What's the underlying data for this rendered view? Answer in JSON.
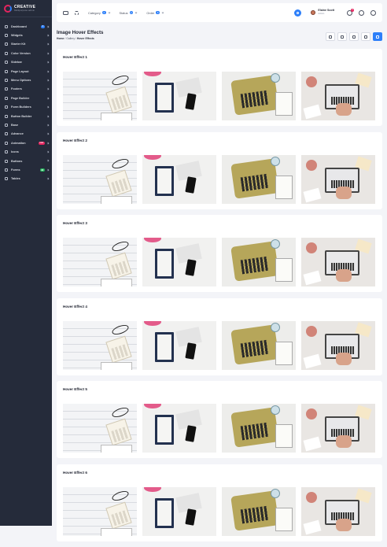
{
  "brand": {
    "name": "CREATIVE",
    "tagline": "Multipurpose admin"
  },
  "sidebar": {
    "items": [
      {
        "label": "Dashboard",
        "icon": "dashboard-icon",
        "badge": "4",
        "badge_color": "#2d7ff9"
      },
      {
        "label": "Widgets",
        "icon": "widgets-icon"
      },
      {
        "label": "Starter Kit",
        "icon": "starter-kit-icon"
      },
      {
        "label": "Color Version",
        "icon": "palette-icon"
      },
      {
        "label": "Sidebar",
        "icon": "sidebar-icon"
      },
      {
        "label": "Page Layout",
        "icon": "layout-icon"
      },
      {
        "label": "Menu Options",
        "icon": "menu-icon"
      },
      {
        "label": "Footers",
        "icon": "footer-icon"
      },
      {
        "label": "Page Builder",
        "icon": "builder-icon"
      },
      {
        "label": "Form Builders",
        "icon": "form-icon"
      },
      {
        "label": "Button Builder",
        "icon": "button-icon"
      },
      {
        "label": "Base",
        "icon": "base-icon"
      },
      {
        "label": "Advance",
        "icon": "advance-icon"
      },
      {
        "label": "Animation",
        "icon": "animation-icon",
        "badge": "Hot",
        "badge_color": "#e5245e"
      },
      {
        "label": "Icons",
        "icon": "icons-icon"
      },
      {
        "label": "Buttons",
        "icon": "buttons-icon"
      },
      {
        "label": "Forms",
        "icon": "forms-icon",
        "badge": "18",
        "badge_color": "#22b35a"
      },
      {
        "label": "Tables",
        "icon": "tables-icon"
      }
    ]
  },
  "topbar": {
    "filters": [
      {
        "label": "Category",
        "count": "4"
      },
      {
        "label": "Status",
        "count": "2"
      },
      {
        "label": "Order",
        "count": "6"
      }
    ],
    "user": {
      "name": "Elaine Scott",
      "role": "Admin"
    },
    "notification_count": "4"
  },
  "page": {
    "title": "Image Hover Effects",
    "breadcrumb": {
      "home": "Home",
      "sep": "/",
      "section": "Gallery",
      "current": "Hover Effects"
    }
  },
  "cards": [
    {
      "title": "Hover Effect 1"
    },
    {
      "title": "Hover Effect 2"
    },
    {
      "title": "Hover Effect 3"
    },
    {
      "title": "Hover Effect 4"
    },
    {
      "title": "Hover Effect 5"
    },
    {
      "title": "Hover Effect 6"
    }
  ],
  "images": [
    {
      "name": "desk-calculator-photo"
    },
    {
      "name": "notebook-phone-photo"
    },
    {
      "name": "typewriter-photo"
    },
    {
      "name": "laptop-desk-photo"
    }
  ],
  "colors": {
    "sidebar": "#252b3a",
    "accent": "#2d7ff9",
    "danger": "#e5245e",
    "success": "#22b35a"
  }
}
